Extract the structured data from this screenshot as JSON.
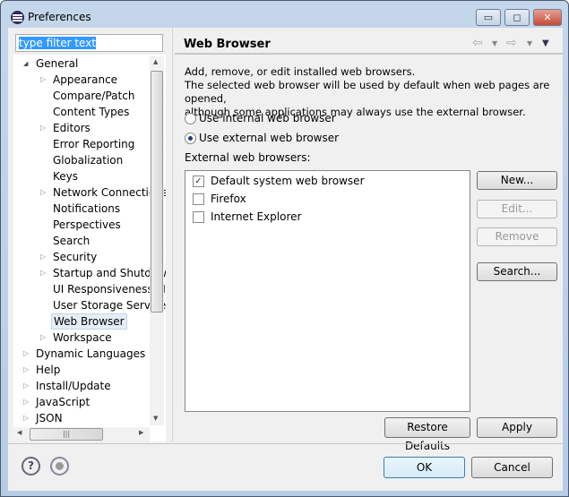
{
  "window": {
    "title": "Preferences",
    "min": "▭",
    "max": "◻",
    "close": "✕"
  },
  "filter": {
    "value": "type filter text"
  },
  "tree": [
    {
      "label": "General",
      "level": 0,
      "expanded": true
    },
    {
      "label": "Appearance",
      "level": 1,
      "expandable": true
    },
    {
      "label": "Compare/Patch",
      "level": 1
    },
    {
      "label": "Content Types",
      "level": 1
    },
    {
      "label": "Editors",
      "level": 1,
      "expandable": true
    },
    {
      "label": "Error Reporting",
      "level": 1
    },
    {
      "label": "Globalization",
      "level": 1
    },
    {
      "label": "Keys",
      "level": 1
    },
    {
      "label": "Network Connections",
      "level": 1,
      "expandable": true
    },
    {
      "label": "Notifications",
      "level": 1
    },
    {
      "label": "Perspectives",
      "level": 1
    },
    {
      "label": "Search",
      "level": 1
    },
    {
      "label": "Security",
      "level": 1,
      "expandable": true
    },
    {
      "label": "Startup and Shutdown",
      "level": 1,
      "expandable": true
    },
    {
      "label": "UI Responsiveness Monitoring",
      "level": 1
    },
    {
      "label": "User Storage Service",
      "level": 1
    },
    {
      "label": "Web Browser",
      "level": 1,
      "selected": true
    },
    {
      "label": "Workspace",
      "level": 1,
      "expandable": true
    },
    {
      "label": "Dynamic Languages",
      "level": 0,
      "expandable": true
    },
    {
      "label": "Help",
      "level": 0,
      "expandable": true
    },
    {
      "label": "Install/Update",
      "level": 0,
      "expandable": true
    },
    {
      "label": "JavaScript",
      "level": 0,
      "expandable": true
    },
    {
      "label": "JSON",
      "level": 0,
      "expandable": true
    }
  ],
  "page": {
    "title": "Web Browser",
    "desc1": "Add, remove, or edit installed web browsers.",
    "desc2": "The selected web browser will be used by default when web pages are opened,",
    "desc3": "although some applications may always use the external browser.",
    "radio_internal": "Use internal web browser",
    "radio_external": "Use external web browser",
    "selected_radio": "external",
    "list_label": "External web browsers:",
    "browsers": [
      {
        "label": "Default system web browser",
        "checked": true
      },
      {
        "label": "Firefox",
        "checked": false
      },
      {
        "label": "Internet Explorer",
        "checked": false
      }
    ],
    "new": "New...",
    "edit": "Edit...",
    "remove": "Remove",
    "search": "Search...",
    "restore": "Restore Defaults",
    "apply": "Apply"
  },
  "footer": {
    "ok": "OK",
    "cancel": "Cancel"
  }
}
